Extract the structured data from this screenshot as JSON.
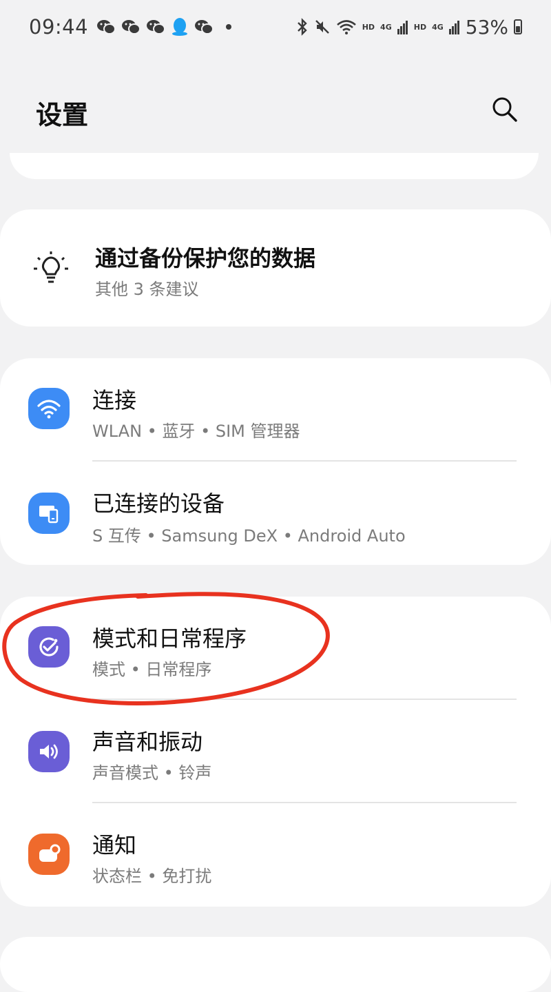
{
  "status_bar": {
    "time": "09:44",
    "notification_icons": [
      "wechat-icon",
      "wechat-icon",
      "wechat-icon",
      "qq-icon",
      "wechat-icon"
    ],
    "network_label_1": "HD",
    "network_label_2": "4G",
    "network_label_3": "HD",
    "network_label_4": "4G",
    "battery": "53%"
  },
  "header": {
    "title": "设置"
  },
  "suggestion": {
    "title": "通过备份保护您的数据",
    "subtitle": "其他 3 条建议"
  },
  "settings": [
    {
      "title": "连接",
      "subtitle": "WLAN • 蓝牙 • SIM 管理器",
      "icon": "wifi-icon",
      "color": "#3d8cf5"
    },
    {
      "title": "已连接的设备",
      "subtitle": "S 互传 • Samsung DeX • Android Auto",
      "icon": "connected-devices-icon",
      "color": "#3d8cf5"
    },
    {
      "title": "模式和日常程序",
      "subtitle": "模式 • 日常程序",
      "icon": "modes-routines-icon",
      "color": "#6a5ed6"
    },
    {
      "title": "声音和振动",
      "subtitle": "声音模式 • 铃声",
      "icon": "speaker-icon",
      "color": "#6a5ed6"
    },
    {
      "title": "通知",
      "subtitle": "状态栏 • 免打扰",
      "icon": "notification-icon",
      "color": "#ef6a2c"
    }
  ],
  "annotation_color": "#e8321f"
}
